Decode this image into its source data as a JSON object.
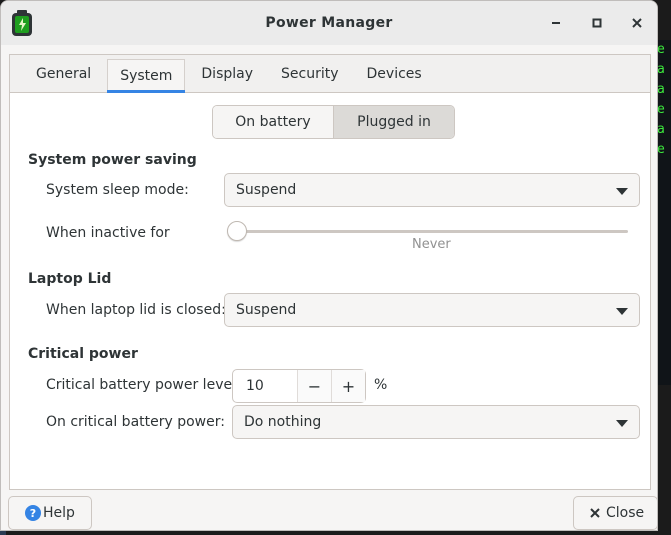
{
  "window": {
    "title": "Power Manager",
    "controls": {
      "minimize": "–",
      "maximize": "□",
      "close": "✕"
    }
  },
  "tabs": [
    {
      "label": "General"
    },
    {
      "label": "System",
      "active": true
    },
    {
      "label": "Display"
    },
    {
      "label": "Security"
    },
    {
      "label": "Devices"
    }
  ],
  "mode_switch": {
    "on_battery": "On battery",
    "plugged_in": "Plugged in",
    "selected": "Plugged in"
  },
  "system_power_saving": {
    "title": "System power saving",
    "sleep_mode_label": "System sleep mode:",
    "sleep_mode_value": "Suspend",
    "inactive_label": "When inactive for",
    "inactive_value": "Never",
    "inactive_level": 0
  },
  "laptop_lid": {
    "title": "Laptop Lid",
    "closed_label": "When laptop lid is closed:",
    "closed_value": "Suspend"
  },
  "critical_power": {
    "title": "Critical power",
    "level_label": "Critical battery power level:",
    "level_value": "10",
    "level_unit": "%",
    "minus": "−",
    "plus": "+",
    "action_label": "On critical battery power:",
    "action_value": "Do nothing"
  },
  "footer": {
    "help_label": "Help",
    "close_label": "Close"
  },
  "colors": {
    "accent": "#3584e4",
    "battery_icon": "#1f9e1f"
  }
}
